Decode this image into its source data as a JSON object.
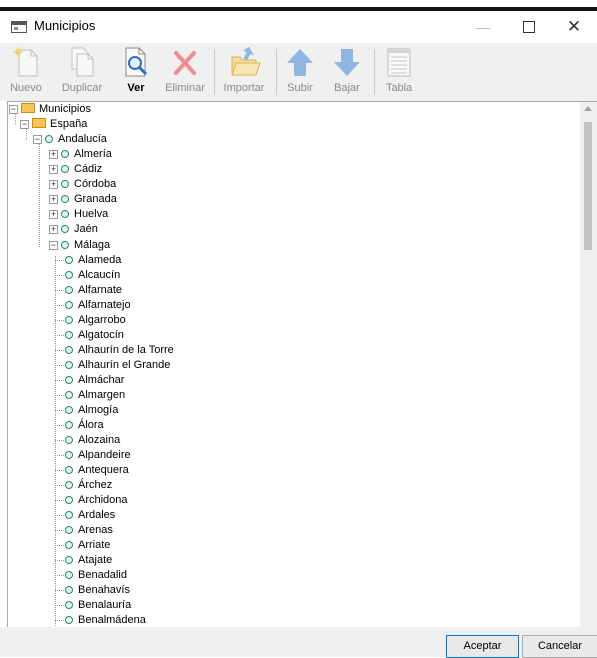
{
  "window": {
    "title": "Municipios"
  },
  "toolbar": {
    "buttons": [
      {
        "label": "Nuevo",
        "icon": "new-document-icon",
        "enabled": false
      },
      {
        "label": "Duplicar",
        "icon": "duplicate-icon",
        "enabled": false
      },
      {
        "label": "Ver",
        "icon": "view-icon",
        "enabled": true
      },
      {
        "label": "Eliminar",
        "icon": "delete-icon",
        "enabled": false
      },
      {
        "label": "Importar",
        "icon": "import-icon",
        "enabled": false
      },
      {
        "label": "Subir",
        "icon": "up-arrow-icon",
        "enabled": false
      },
      {
        "label": "Bajar",
        "icon": "down-arrow-icon",
        "enabled": false
      },
      {
        "label": "Tabla",
        "icon": "table-icon",
        "enabled": false
      }
    ]
  },
  "tree": {
    "root": "Municipios",
    "country": "España",
    "region": "Andalucía",
    "provinces": [
      "Almería",
      "Cádiz",
      "Córdoba",
      "Granada",
      "Huelva",
      "Jaén"
    ],
    "expanded_province": "Málaga",
    "municipalities": [
      "Alameda",
      "Alcaucín",
      "Alfarnate",
      "Alfarnatejo",
      "Algarrobo",
      "Algatocín",
      "Alhaurín de la Torre",
      "Alhaurín el Grande",
      "Almáchar",
      "Almargen",
      "Almogía",
      "Álora",
      "Alozaina",
      "Alpandeire",
      "Antequera",
      "Árchez",
      "Archidona",
      "Ardales",
      "Arenas",
      "Arriate",
      "Atajate",
      "Benadalid",
      "Benahavís",
      "Benalauría",
      "Benalmádena"
    ]
  },
  "footer": {
    "accept_label": "Aceptar",
    "cancel_label": "Cancelar"
  },
  "colors": {
    "accent": "#0078d7",
    "node_dot": "#1c8b6f",
    "folder": "#f5c55a"
  }
}
